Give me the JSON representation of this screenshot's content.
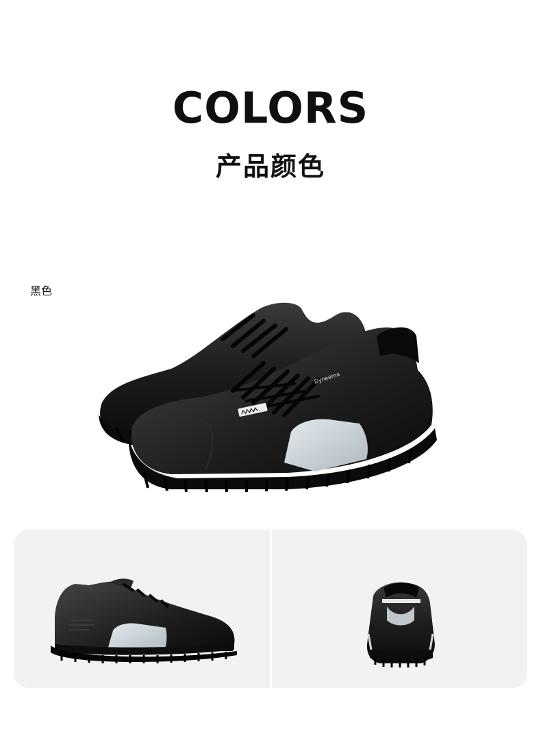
{
  "header": {
    "title": "COLORS",
    "subtitle": "产品颜色"
  },
  "color_variants": [
    {
      "label": "黑色"
    }
  ],
  "hero_image": {
    "icon": "shoe-pair-image",
    "badge_text": "Dyneema"
  },
  "gallery": {
    "items": [
      {
        "icon": "shoe-side-view-image"
      },
      {
        "icon": "shoe-back-view-image"
      }
    ]
  },
  "colors": {
    "page_background": "#ffffff",
    "panel_background": "#f2f2f2",
    "shoe_leather": "#1c1c1c",
    "heel_accent": "#cfd6dc"
  }
}
